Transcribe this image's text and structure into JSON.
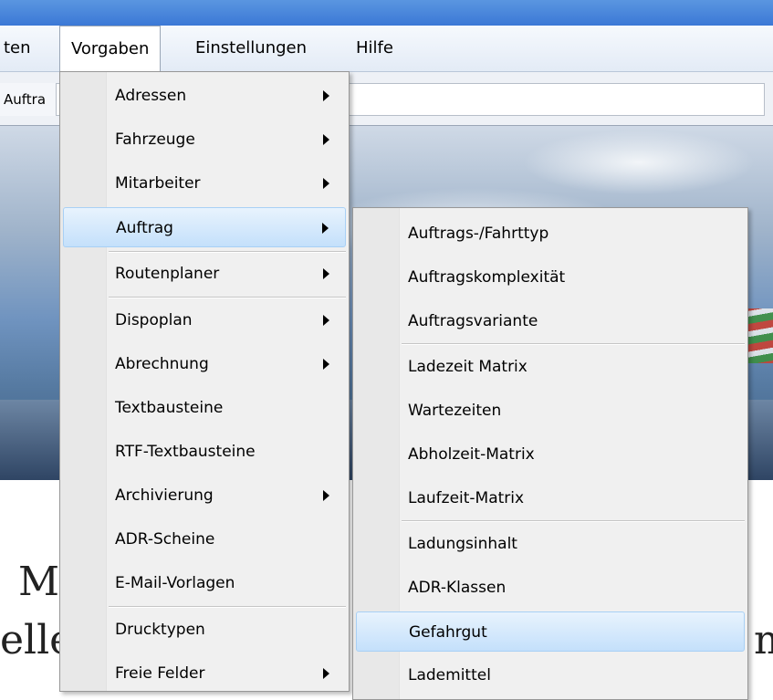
{
  "menubar": {
    "items": [
      {
        "label": "ten"
      },
      {
        "label": "Vorgaben"
      },
      {
        "label": "Einstellungen"
      },
      {
        "label": "Hilfe"
      }
    ]
  },
  "toolbar": {
    "tab_label": "Auftra"
  },
  "background_text": {
    "line1": "M",
    "line2": "elle",
    "line3": "m"
  },
  "vorgaben_menu": {
    "items": [
      {
        "label": "Adressen"
      },
      {
        "label": "Fahrzeuge"
      },
      {
        "label": "Mitarbeiter"
      },
      {
        "label": "Auftrag"
      },
      {
        "label": "Routenplaner"
      },
      {
        "label": "Dispoplan"
      },
      {
        "label": "Abrechnung"
      },
      {
        "label": "Textbausteine"
      },
      {
        "label": "RTF-Textbausteine"
      },
      {
        "label": "Archivierung"
      },
      {
        "label": "ADR-Scheine"
      },
      {
        "label": "E-Mail-Vorlagen"
      },
      {
        "label": "Drucktypen"
      },
      {
        "label": "Freie Felder"
      }
    ]
  },
  "auftrag_submenu": {
    "items": [
      {
        "label": "Auftrags-/Fahrttyp"
      },
      {
        "label": "Auftragskomplexität"
      },
      {
        "label": "Auftragsvariante"
      },
      {
        "label": "Ladezeit Matrix"
      },
      {
        "label": "Wartezeiten"
      },
      {
        "label": "Abholzeit-Matrix"
      },
      {
        "label": "Laufzeit-Matrix"
      },
      {
        "label": "Ladungsinhalt"
      },
      {
        "label": "ADR-Klassen"
      },
      {
        "label": "Gefahrgut"
      },
      {
        "label": "Lademittel"
      }
    ]
  }
}
